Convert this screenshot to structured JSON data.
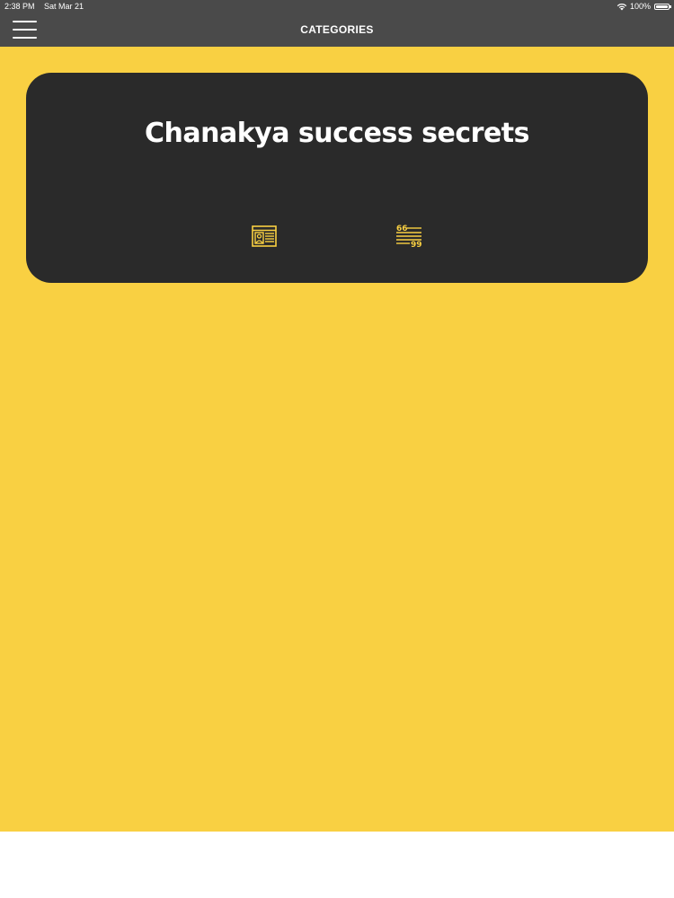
{
  "status_bar": {
    "time": "2:38 PM",
    "date": "Sat Mar 21",
    "battery": "100%",
    "wifi_icon": "wifi-icon",
    "battery_icon": "battery-icon"
  },
  "nav": {
    "title": "CATEGORIES",
    "menu_icon": "hamburger-menu-icon"
  },
  "categories": [
    {
      "title": "Chanakya success secrets",
      "icons": [
        "info-card-icon",
        "quotes-list-icon"
      ]
    }
  ],
  "colors": {
    "background": "#f9d042",
    "card": "#2a2a2a",
    "nav_bar": "#4a4a4a",
    "accent": "#f9d042",
    "text": "#ffffff"
  }
}
